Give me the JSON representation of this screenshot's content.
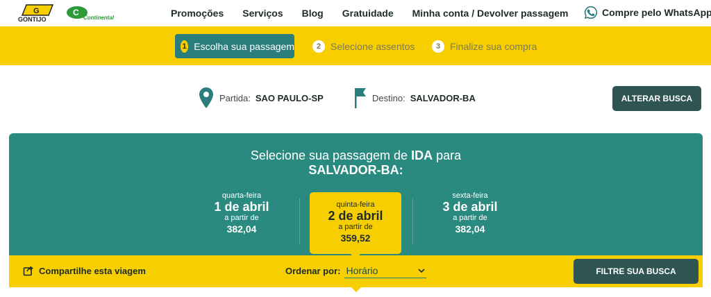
{
  "brand": {
    "gontijo_logo_text": "GONTIJO",
    "continental_logo_text": "Continental",
    "yellow": "#f7cf00",
    "teal": "#2a8a80",
    "dark_teal": "#2f5553"
  },
  "nav": {
    "items": [
      {
        "label": "Promoções"
      },
      {
        "label": "Serviços"
      },
      {
        "label": "Blog"
      },
      {
        "label": "Gratuidade"
      },
      {
        "label": "Minha conta / Devolver passagem"
      }
    ],
    "whatsapp_label": "Compre pelo WhatsApp",
    "whatsapp_icon": "whatsapp-icon"
  },
  "steps": [
    {
      "number": "1",
      "label": "Escolha sua passagem",
      "active": true
    },
    {
      "number": "2",
      "label": "Selecione assentos",
      "active": false
    },
    {
      "number": "3",
      "label": "Finalize sua compra",
      "active": false
    }
  ],
  "route": {
    "origin_label": "Partida:",
    "origin_value": "SAO PAULO-SP",
    "origin_icon": "map-pin-icon",
    "destination_label": "Destino:",
    "destination_value": "SALVADOR-BA",
    "destination_icon": "flag-icon",
    "change_button": "ALTERAR BUSCA"
  },
  "selection": {
    "title_prefix": "Selecione sua passagem de ",
    "title_ida": "IDA",
    "title_suffix": " para",
    "title_destination": "SALVADOR-BA:",
    "dates": [
      {
        "weekday": "quarta-feira",
        "date": "1 de abril",
        "from_label": "a partir de",
        "price": "382,04",
        "selected": false
      },
      {
        "weekday": "quinta-feira",
        "date": "2 de abril",
        "from_label": "a partir de",
        "price": "359,52",
        "selected": true
      },
      {
        "weekday": "sexta-feira",
        "date": "3 de abril",
        "from_label": "a partir de",
        "price": "382,04",
        "selected": false
      }
    ]
  },
  "bottom": {
    "share_label": "Compartilhe esta viagem",
    "share_icon": "share-icon",
    "order_label": "Ordenar por:",
    "order_value": "Horário",
    "filter_button": "FILTRE SUA BUSCA"
  }
}
